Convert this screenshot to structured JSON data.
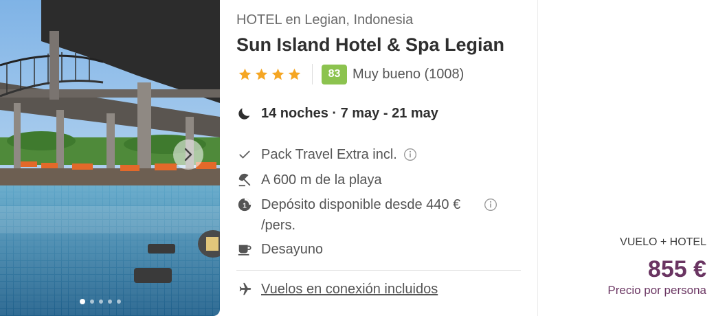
{
  "hotel": {
    "type_location": "HOTEL en Legian, Indonesia",
    "name": "Sun Island Hotel & Spa Legian",
    "stars": 4,
    "score": "83",
    "score_text": "Muy bueno (1008)",
    "colors": {
      "score_bg": "#8cc34f",
      "star": "#f5a623",
      "price": "#6a3562"
    }
  },
  "stay": {
    "nights": "14 noches · 7 may - 21 may"
  },
  "features": [
    {
      "icon": "check-icon",
      "text": "Pack Travel Extra incl.",
      "info": true
    },
    {
      "icon": "beach-umbrella-icon",
      "text": "A 600 m de la playa",
      "info": false
    },
    {
      "icon": "deposit-icon",
      "text": "Depósito disponible desde 440 €",
      "text2": "/pers.",
      "info": true
    },
    {
      "icon": "coffee-cup-icon",
      "text": "Desayuno",
      "info": false
    }
  ],
  "flights": {
    "icon": "airplane-icon",
    "text": "Vuelos en conexión incluidos"
  },
  "gallery": {
    "dots": 5,
    "active_dot": 1
  },
  "price": {
    "package": "VUELO + HOTEL",
    "amount": "855 €",
    "per_person": "Precio por persona"
  }
}
